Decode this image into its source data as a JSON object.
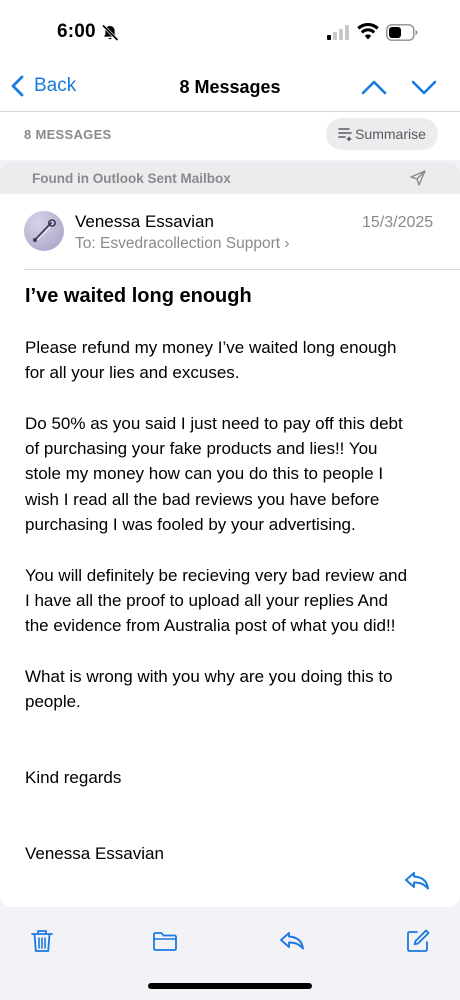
{
  "status_bar": {
    "time": "6:00"
  },
  "nav": {
    "back_label": "Back",
    "title": "8 Messages"
  },
  "subheader": {
    "count_label": "8 MESSAGES",
    "summarise_label": "Summarise"
  },
  "mail": {
    "found_in": "Found in Outlook Sent Mailbox",
    "sender": "Venessa Essavian",
    "date": "15/3/2025",
    "to_prefix": "To:",
    "to_name": "Esvedracollection Support",
    "subject": "I’ve waited long enough",
    "body": {
      "p1_l1": "Please refund my money I’ve waited long enough",
      "p1_l2": "for all your lies and excuses.",
      "p2_l1": "Do 50% as you said I just need to pay off this debt",
      "p2_l2": "of purchasing your fake products and lies!! You",
      "p2_l3": "stole my money how can you do this to people I",
      "p2_l4": "wish I read all the bad reviews you have before",
      "p2_l5": "purchasing I was fooled by your advertising.",
      "p3_l1": "You will definitely be recieving very bad review and",
      "p3_l2": "I have all the proof to upload all your replies And",
      "p3_l3": "the evidence from Australia post of what you did!!",
      "p4_l1": "What is wrong with you why are you doing this to",
      "p4_l2": "people.",
      "closing": "Kind regards",
      "signature": "Venessa Essavian"
    }
  },
  "icons": {
    "status": [
      "bell-slash-icon",
      "cellular-signal-icon",
      "wifi-icon",
      "battery-icon"
    ],
    "nav": [
      "chevron-left-icon",
      "chevron-up-icon",
      "chevron-down-icon"
    ],
    "toolbar": [
      "trash-icon",
      "folder-icon",
      "reply-icon",
      "compose-icon"
    ]
  },
  "colors": {
    "accent": "#1a7ae0",
    "secondary_text": "#8a8a8e",
    "background": "#f2f2f7"
  }
}
